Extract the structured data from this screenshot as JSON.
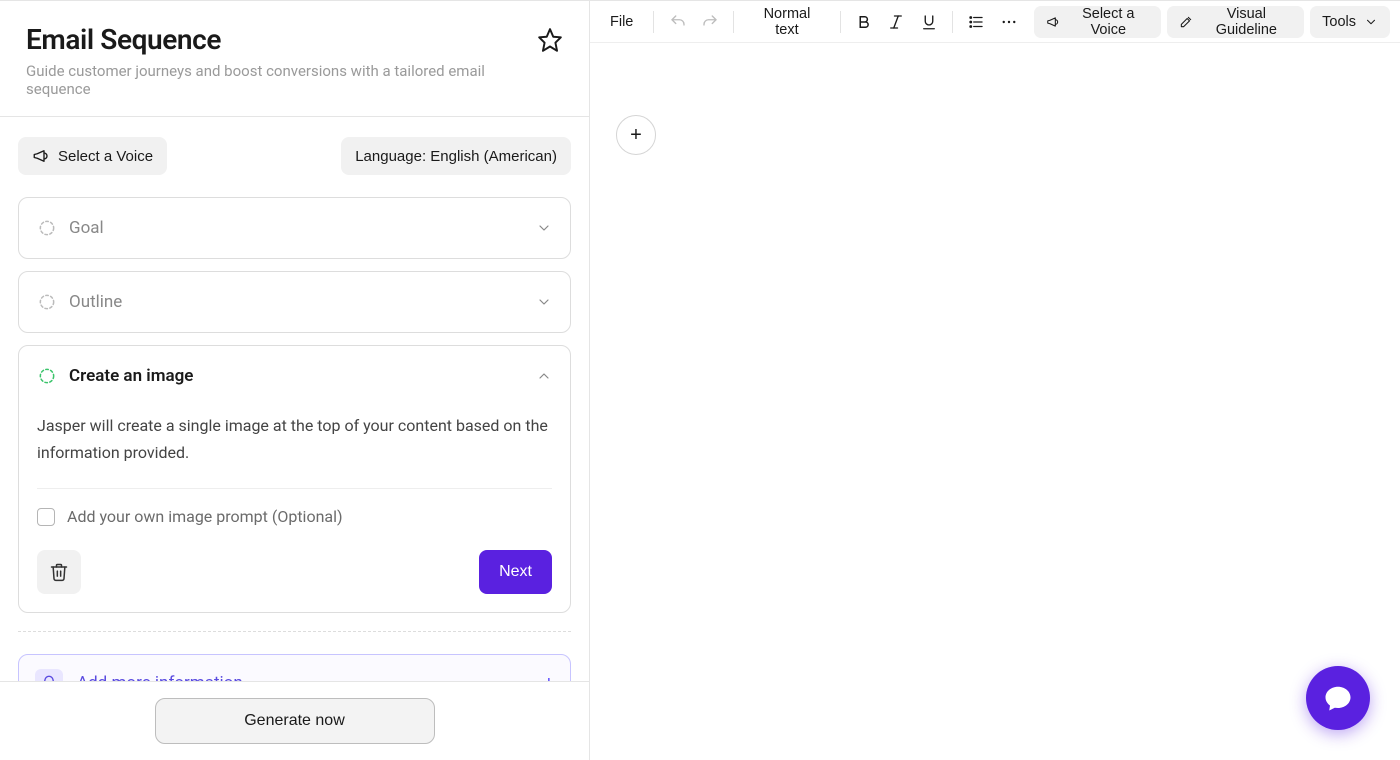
{
  "header": {
    "title": "Email Sequence",
    "subtitle": "Guide customer journeys and boost conversions with a tailored email sequence"
  },
  "controls": {
    "voiceLabel": "Select a Voice",
    "languageLabel": "Language: English (American)"
  },
  "steps": {
    "goal": {
      "label": "Goal"
    },
    "outline": {
      "label": "Outline"
    },
    "image": {
      "label": "Create an image",
      "desc": "Jasper will create a single image at the top of your content based on the information provided.",
      "promptCheckboxLabel": "Add your own image prompt (Optional)",
      "nextLabel": "Next"
    }
  },
  "addMore": {
    "label": "Add more information"
  },
  "footer": {
    "generateLabel": "Generate now"
  },
  "toolbar": {
    "file": "File",
    "style": "Normal text",
    "voice": "Select a Voice",
    "visual": "Visual Guideline",
    "tools": "Tools"
  }
}
